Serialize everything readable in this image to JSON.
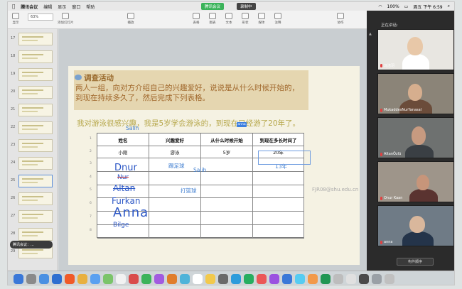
{
  "menubar": {
    "app": "腾讯会议",
    "menus": [
      "编辑",
      "显示",
      "窗口",
      "帮助"
    ],
    "meeting_pill_left": "腾讯会议",
    "meeting_pill_right": "录制中",
    "battery": "100%",
    "clock": "周五 下午 6:59"
  },
  "toolbar": {
    "zoom": "63%",
    "items": [
      "显示",
      "缩放",
      "添加幻灯片",
      "播放",
      "表格",
      "图表",
      "文本",
      "形状",
      "媒体",
      "注释",
      "协作"
    ]
  },
  "navigator": {
    "slide_numbers": [
      "17",
      "18",
      "19",
      "20",
      "21",
      "22",
      "23",
      "24",
      "25",
      "26",
      "27",
      "28",
      "29"
    ],
    "selected_index": 8,
    "toast": "腾讯会议：..."
  },
  "slide": {
    "activity_title": "调查活动",
    "instructions": "两人一组，向对方介绍自己的兴趣爱好，说说是从什么时候开始的，到现在持续多久了，然后完成下列表格。",
    "example": "我对游泳很感兴趣，我是5岁学会游泳的，到现在已经游了20年了。",
    "watermark": "FJR08@shu.edu.cn",
    "table": {
      "headers": [
        "姓名",
        "兴趣爱好",
        "从什么时候开始",
        "到现在多长时间了"
      ],
      "example_row": [
        "小刚",
        "游泳",
        "5岁",
        "20年"
      ],
      "row_numbers": [
        "1",
        "2",
        "3",
        "4",
        "5",
        "6",
        "7",
        "8"
      ],
      "typed": {
        "salih_top": "Salih",
        "hobby1": "踢足球",
        "salih_mid": "Salih",
        "hobby2": "打篮球",
        "duration": "13年",
        "cursor_tag": "anna"
      },
      "handwriting": [
        "Dnur",
        "Nur",
        "Altan",
        "Furkan",
        "Anna",
        "Bilge"
      ]
    }
  },
  "participants": {
    "speaking_label": "正在讲话:",
    "tiles": [
      {
        "name": "冯洁羽"
      },
      {
        "name": "MukaddesNurYanasal"
      },
      {
        "name": "AltanÖzlü"
      },
      {
        "name": "Onur Kaan"
      },
      {
        "name": "anna"
      }
    ],
    "sort_button": "构件顺序"
  },
  "colors": {
    "header_box": "#e5d6b0",
    "title_text": "#9a6a2d",
    "handwriting": "#2d58c6",
    "panel_bg": "#2b2b2b",
    "meeting_green": "#3bb35a"
  }
}
